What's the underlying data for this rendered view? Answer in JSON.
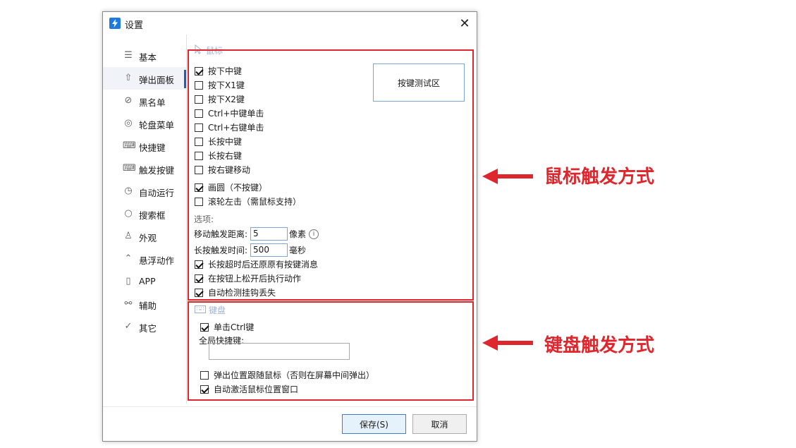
{
  "window": {
    "title": "设置",
    "close_glyph": "✕"
  },
  "sidebar": {
    "items": [
      {
        "label": "基本",
        "icon": "sliders-icon"
      },
      {
        "label": "弹出面板",
        "icon": "popup-panel-icon"
      },
      {
        "label": "黑名单",
        "icon": "ban-icon"
      },
      {
        "label": "轮盘菜单",
        "icon": "wheel-icon"
      },
      {
        "label": "快捷键",
        "icon": "keyboard-icon"
      },
      {
        "label": "触发按键",
        "icon": "keyboard-icon"
      },
      {
        "label": "自动运行",
        "icon": "clock-icon"
      },
      {
        "label": "搜索框",
        "icon": "search-icon"
      },
      {
        "label": "外观",
        "icon": "shirt-icon"
      },
      {
        "label": "悬浮动作",
        "icon": "hover-icon"
      },
      {
        "label": "APP",
        "icon": "phone-icon"
      },
      {
        "label": "辅助",
        "icon": "bike-icon"
      },
      {
        "label": "其它",
        "icon": "check-icon"
      }
    ],
    "active_index": 1
  },
  "mouse": {
    "header": "鼠标",
    "test_area_label": "按键测试区",
    "checkboxes": [
      {
        "label": "按下中键",
        "checked": true
      },
      {
        "label": "按下X1键",
        "checked": false
      },
      {
        "label": "按下X2键",
        "checked": false
      },
      {
        "label": "Ctrl+中键单击",
        "checked": false
      },
      {
        "label": "Ctrl+右键单击",
        "checked": false
      },
      {
        "label": "长按中键",
        "checked": false
      },
      {
        "label": "长按右键",
        "checked": false
      },
      {
        "label": "按右键移动",
        "checked": false
      },
      {
        "label": "画圆（不按键）",
        "checked": true
      },
      {
        "label": "滚轮左击（需鼠标支持）",
        "checked": false
      }
    ],
    "options_label": "选项:",
    "move_distance": {
      "label": "移动触发距离:",
      "value": "5",
      "unit": "像素"
    },
    "long_press_time": {
      "label": "长按触发时间:",
      "value": "500",
      "unit": "毫秒"
    },
    "option_checkboxes": [
      {
        "label": "长按超时后还原原有按键消息",
        "checked": true
      },
      {
        "label": "在按钮上松开后执行动作",
        "checked": true
      },
      {
        "label": "自动检测挂钩丢失",
        "checked": true
      }
    ]
  },
  "keyboard": {
    "header": "键盘",
    "single_ctrl": {
      "label": "单击Ctrl键",
      "checked": true
    },
    "global_hotkey_label": "全局快捷键:",
    "global_hotkey_value": "",
    "follow_mouse": {
      "label": "弹出位置跟随鼠标（否则在屏幕中间弹出）",
      "checked": false
    },
    "auto_activate": {
      "label": "自动激活鼠标位置窗口",
      "checked": true
    }
  },
  "footer": {
    "save_label": "保存(S)",
    "cancel_label": "取消"
  },
  "annotations": {
    "mouse_label": "鼠标触发方式",
    "keyboard_label": "键盘触发方式",
    "color": "#e0262d"
  }
}
